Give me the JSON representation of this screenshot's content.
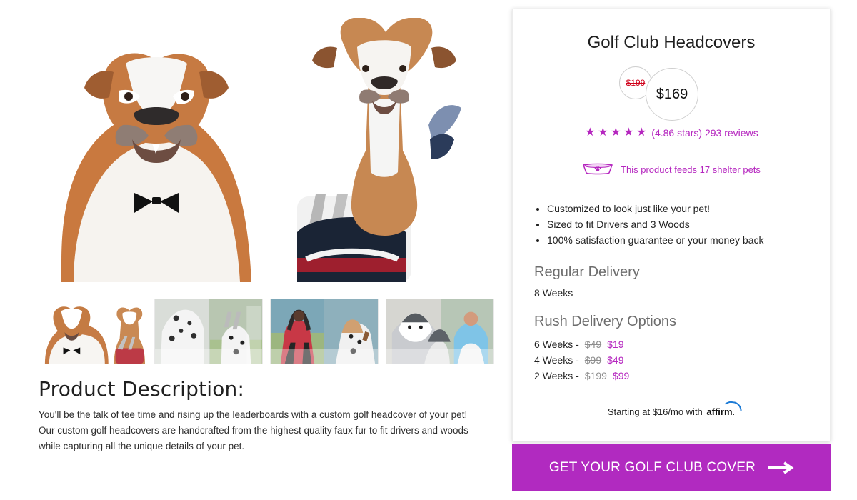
{
  "product": {
    "title": "Golf Club Headcovers",
    "old_price": "$199",
    "new_price": "$169",
    "rating_text": "(4.86 stars) 293 reviews",
    "feeds_text": "This product feeds 17 shelter pets"
  },
  "features": [
    "Customized to look just like your pet!",
    "Sized to fit Drivers and 3 Woods",
    "100% satisfaction guarantee or your money back"
  ],
  "delivery": {
    "regular_heading": "Regular Delivery",
    "regular_value": "8 Weeks",
    "rush_heading": "Rush Delivery Options",
    "rush_options": [
      {
        "label": "6 Weeks -",
        "old_price": "$49",
        "new_price": "$19"
      },
      {
        "label": "4 Weeks -",
        "old_price": "$99",
        "new_price": "$49"
      },
      {
        "label": "2 Weeks -",
        "old_price": "$199",
        "new_price": "$99"
      }
    ]
  },
  "financing": {
    "prefix": "Starting at $16/mo with",
    "brand": "affirm",
    "suffix": "."
  },
  "cta": {
    "label": "GET YOUR GOLF CLUB COVER"
  },
  "description": {
    "title": "Product Description:",
    "text": "You'll be the talk of tee time and rising up the leaderboards with a custom golf headcover of your pet! Our custom golf headcovers are handcrafted from the highest quality faux fur to fit drivers and woods while capturing all the unique details of your pet."
  },
  "colors": {
    "accent": "#b12ac0",
    "accent_text": "#b526bf",
    "sale_red": "#d0021b"
  },
  "icons": {
    "star": "star-icon",
    "bowl": "pet-bowl-icon",
    "arrow": "arrow-right-icon"
  }
}
